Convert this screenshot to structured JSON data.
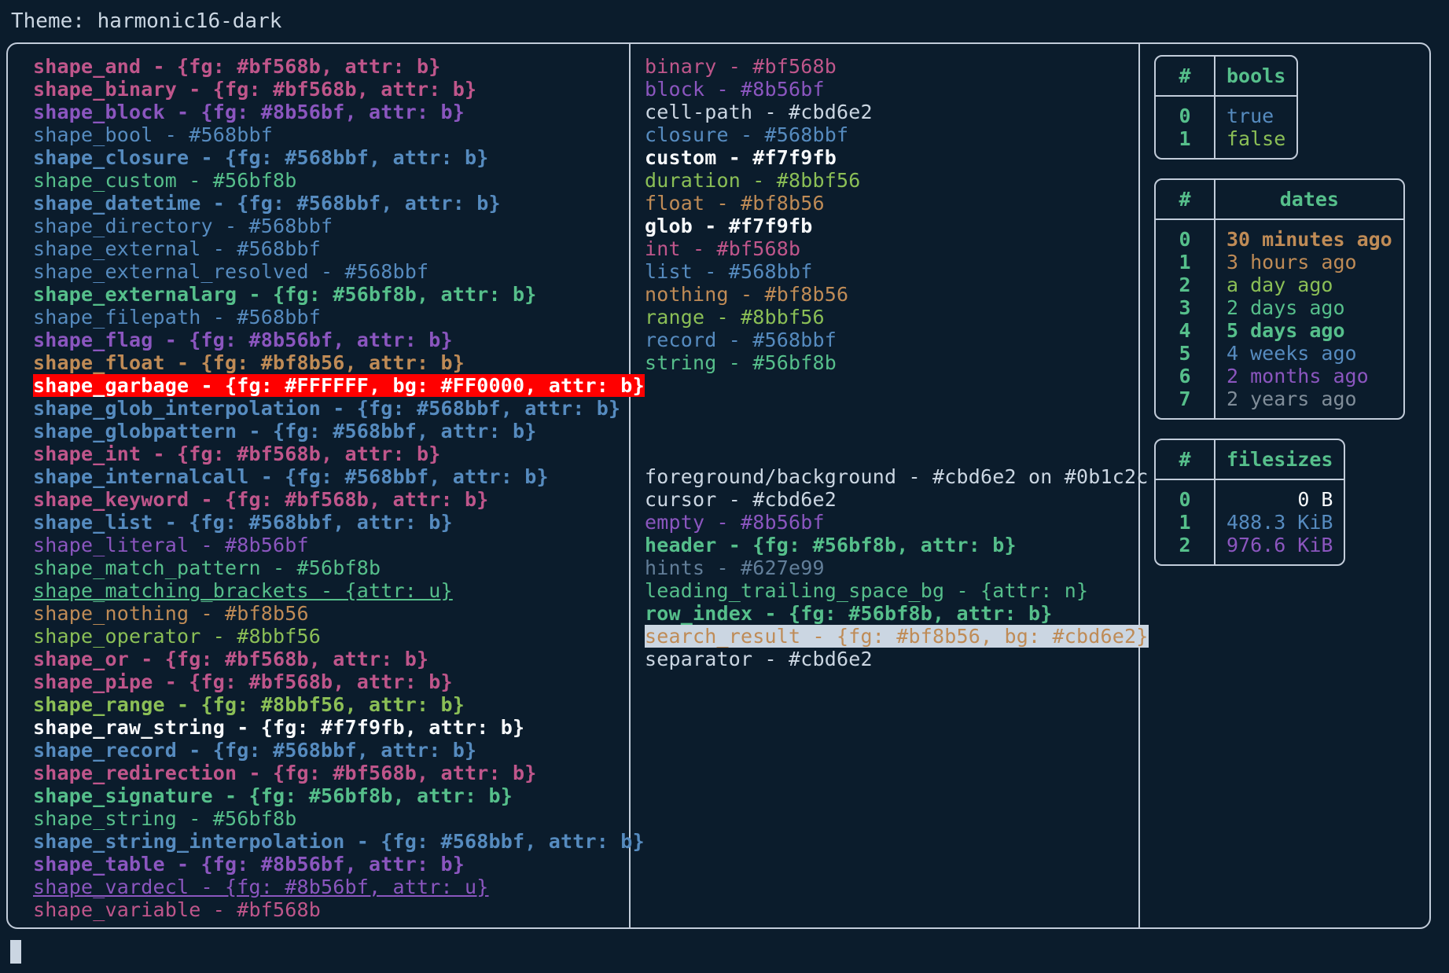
{
  "header": {
    "label": "Theme: harmonic16-dark"
  },
  "colors": {
    "background": "#0b1c2c",
    "foreground": "#cbd6e2",
    "border": "#c2ccda",
    "pink": "#bf568b",
    "purple": "#8b56bf",
    "blue": "#568bbf",
    "green": "#56bf8b",
    "lime": "#8bbf56",
    "orange": "#bf8b56",
    "white": "#f7f9fb",
    "grey": "#627e99",
    "cursor": "#cbd6e2",
    "garbage_fg": "#FFFFFF",
    "garbage_bg": "#FF0000",
    "search_bg": "#cbd6e2"
  },
  "shapes": [
    {
      "text": "shape_and - {fg: #bf568b, attr: b}",
      "fg": "#bf568b",
      "bold": true
    },
    {
      "text": "shape_binary - {fg: #bf568b, attr: b}",
      "fg": "#bf568b",
      "bold": true
    },
    {
      "text": "shape_block - {fg: #8b56bf, attr: b}",
      "fg": "#8b56bf",
      "bold": true
    },
    {
      "text": "shape_bool - #568bbf",
      "fg": "#568bbf",
      "bold": false
    },
    {
      "text": "shape_closure - {fg: #568bbf, attr: b}",
      "fg": "#568bbf",
      "bold": true
    },
    {
      "text": "shape_custom - #56bf8b",
      "fg": "#56bf8b",
      "bold": false
    },
    {
      "text": "shape_datetime - {fg: #568bbf, attr: b}",
      "fg": "#568bbf",
      "bold": true
    },
    {
      "text": "shape_directory - #568bbf",
      "fg": "#568bbf",
      "bold": false
    },
    {
      "text": "shape_external - #568bbf",
      "fg": "#568bbf",
      "bold": false
    },
    {
      "text": "shape_external_resolved - #568bbf",
      "fg": "#568bbf",
      "bold": false
    },
    {
      "text": "shape_externalarg - {fg: #56bf8b, attr: b}",
      "fg": "#56bf8b",
      "bold": true
    },
    {
      "text": "shape_filepath - #568bbf",
      "fg": "#568bbf",
      "bold": false
    },
    {
      "text": "shape_flag - {fg: #8b56bf, attr: b}",
      "fg": "#8b56bf",
      "bold": true
    },
    {
      "text": "shape_float - {fg: #bf8b56, attr: b}",
      "fg": "#bf8b56",
      "bold": true
    },
    {
      "text": "shape_garbage - {fg: #FFFFFF, bg: #FF0000, attr: b}",
      "fg": "#FFFFFF",
      "bg": "#FF0000",
      "bold": true
    },
    {
      "text": "shape_glob_interpolation - {fg: #568bbf, attr: b}",
      "fg": "#568bbf",
      "bold": true
    },
    {
      "text": "shape_globpattern - {fg: #568bbf, attr: b}",
      "fg": "#568bbf",
      "bold": true
    },
    {
      "text": "shape_int - {fg: #bf568b, attr: b}",
      "fg": "#bf568b",
      "bold": true
    },
    {
      "text": "shape_internalcall - {fg: #568bbf, attr: b}",
      "fg": "#568bbf",
      "bold": true
    },
    {
      "text": "shape_keyword - {fg: #bf568b, attr: b}",
      "fg": "#bf568b",
      "bold": true
    },
    {
      "text": "shape_list - {fg: #568bbf, attr: b}",
      "fg": "#568bbf",
      "bold": true
    },
    {
      "text": "shape_literal - #8b56bf",
      "fg": "#8b56bf",
      "bold": false
    },
    {
      "text": "shape_match_pattern - #56bf8b",
      "fg": "#56bf8b",
      "bold": false
    },
    {
      "text": "shape_matching_brackets - {attr: u}",
      "fg": "#56bf8b",
      "bold": false,
      "underline": true
    },
    {
      "text": "shape_nothing - #bf8b56",
      "fg": "#bf8b56",
      "bold": false
    },
    {
      "text": "shape_operator - #8bbf56",
      "fg": "#8bbf56",
      "bold": false
    },
    {
      "text": "shape_or - {fg: #bf568b, attr: b}",
      "fg": "#bf568b",
      "bold": true
    },
    {
      "text": "shape_pipe - {fg: #bf568b, attr: b}",
      "fg": "#bf568b",
      "bold": true
    },
    {
      "text": "shape_range - {fg: #8bbf56, attr: b}",
      "fg": "#8bbf56",
      "bold": true
    },
    {
      "text": "shape_raw_string - {fg: #f7f9fb, attr: b}",
      "fg": "#f7f9fb",
      "bold": true
    },
    {
      "text": "shape_record - {fg: #568bbf, attr: b}",
      "fg": "#568bbf",
      "bold": true
    },
    {
      "text": "shape_redirection - {fg: #bf568b, attr: b}",
      "fg": "#bf568b",
      "bold": true
    },
    {
      "text": "shape_signature - {fg: #56bf8b, attr: b}",
      "fg": "#56bf8b",
      "bold": true
    },
    {
      "text": "shape_string - #56bf8b",
      "fg": "#56bf8b",
      "bold": false
    },
    {
      "text": "shape_string_interpolation - {fg: #568bbf, attr: b}",
      "fg": "#568bbf",
      "bold": true
    },
    {
      "text": "shape_table - {fg: #8b56bf, attr: b}",
      "fg": "#8b56bf",
      "bold": true
    },
    {
      "text": "shape_vardecl - {fg: #8b56bf, attr: u}",
      "fg": "#8b56bf",
      "bold": false,
      "underline": true
    },
    {
      "text": "shape_variable - #bf568b",
      "fg": "#bf568b",
      "bold": false
    }
  ],
  "types": [
    {
      "text": "binary - #bf568b",
      "fg": "#bf568b",
      "bold": false
    },
    {
      "text": "block - #8b56bf",
      "fg": "#8b56bf",
      "bold": false
    },
    {
      "text": "cell-path - #cbd6e2",
      "fg": "#cbd6e2",
      "bold": false
    },
    {
      "text": "closure - #568bbf",
      "fg": "#568bbf",
      "bold": false
    },
    {
      "text": "custom - #f7f9fb",
      "fg": "#f7f9fb",
      "bold": true
    },
    {
      "text": "duration - #8bbf56",
      "fg": "#8bbf56",
      "bold": false
    },
    {
      "text": "float - #bf8b56",
      "fg": "#bf8b56",
      "bold": false
    },
    {
      "text": "glob - #f7f9fb",
      "fg": "#f7f9fb",
      "bold": true
    },
    {
      "text": "int - #bf568b",
      "fg": "#bf568b",
      "bold": false
    },
    {
      "text": "list - #568bbf",
      "fg": "#568bbf",
      "bold": false
    },
    {
      "text": "nothing - #bf8b56",
      "fg": "#bf8b56",
      "bold": false
    },
    {
      "text": "range - #8bbf56",
      "fg": "#8bbf56",
      "bold": false
    },
    {
      "text": "record - #568bbf",
      "fg": "#568bbf",
      "bold": false
    },
    {
      "text": "string - #56bf8b",
      "fg": "#56bf8b",
      "bold": false
    }
  ],
  "ui_elements": [
    {
      "text": "foreground/background - #cbd6e2 on #0b1c2c",
      "fg": "#cbd6e2",
      "bold": false
    },
    {
      "text": "cursor - #cbd6e2",
      "fg": "#cbd6e2",
      "bold": false
    },
    {
      "text": "empty - #8b56bf",
      "fg": "#8b56bf",
      "bold": false
    },
    {
      "text": "header - {fg: #56bf8b, attr: b}",
      "fg": "#56bf8b",
      "bold": true
    },
    {
      "text": "hints - #627e99",
      "fg": "#627e99",
      "bold": false
    },
    {
      "text": "leading_trailing_space_bg - {attr: n}",
      "fg": "#56bf8b",
      "bold": false
    },
    {
      "text": "row_index - {fg: #56bf8b, attr: b}",
      "fg": "#56bf8b",
      "bold": true
    },
    {
      "text": "search_result - {fg: #bf8b56, bg: #cbd6e2}",
      "fg": "#bf8b56",
      "bg": "#cbd6e2",
      "bold": false
    },
    {
      "text": "separator - #cbd6e2",
      "fg": "#cbd6e2",
      "bold": false
    }
  ],
  "tables": [
    {
      "name": "bools",
      "index_header": "#",
      "value_header": "bools",
      "align": "left",
      "rows": [
        {
          "index": "0",
          "value": "true",
          "fg": "#568bbf"
        },
        {
          "index": "1",
          "value": "false",
          "fg": "#8bbf56"
        }
      ]
    },
    {
      "name": "dates",
      "index_header": "#",
      "value_header": "dates",
      "align": "left",
      "rows": [
        {
          "index": "0",
          "value": "30 minutes ago",
          "fg": "#bf8b56",
          "bold": true
        },
        {
          "index": "1",
          "value": "3 hours ago",
          "fg": "#bf8b56",
          "bold": false
        },
        {
          "index": "2",
          "value": "a day ago",
          "fg": "#8bbf56",
          "bold": false
        },
        {
          "index": "3",
          "value": "2 days ago",
          "fg": "#56bf8b",
          "bold": false
        },
        {
          "index": "4",
          "value": "5 days ago",
          "fg": "#56bf8b",
          "bold": true
        },
        {
          "index": "5",
          "value": "4 weeks ago",
          "fg": "#568bbf",
          "bold": false
        },
        {
          "index": "6",
          "value": "2 months ago",
          "fg": "#8b56bf",
          "bold": false
        },
        {
          "index": "7",
          "value": "2 years ago",
          "fg": "#808d99",
          "bold": false
        }
      ]
    },
    {
      "name": "filesizes",
      "index_header": "#",
      "value_header": "filesizes",
      "align": "right",
      "rows": [
        {
          "index": "0",
          "value": "0 B",
          "fg": "#f7f9fb",
          "bold": false
        },
        {
          "index": "1",
          "value": "488.3 KiB",
          "fg": "#568bbf",
          "bold": false
        },
        {
          "index": "2",
          "value": "976.6 KiB",
          "fg": "#8b56bf",
          "bold": false
        }
      ]
    }
  ],
  "prompt": {
    "cursor": "block-cursor"
  }
}
